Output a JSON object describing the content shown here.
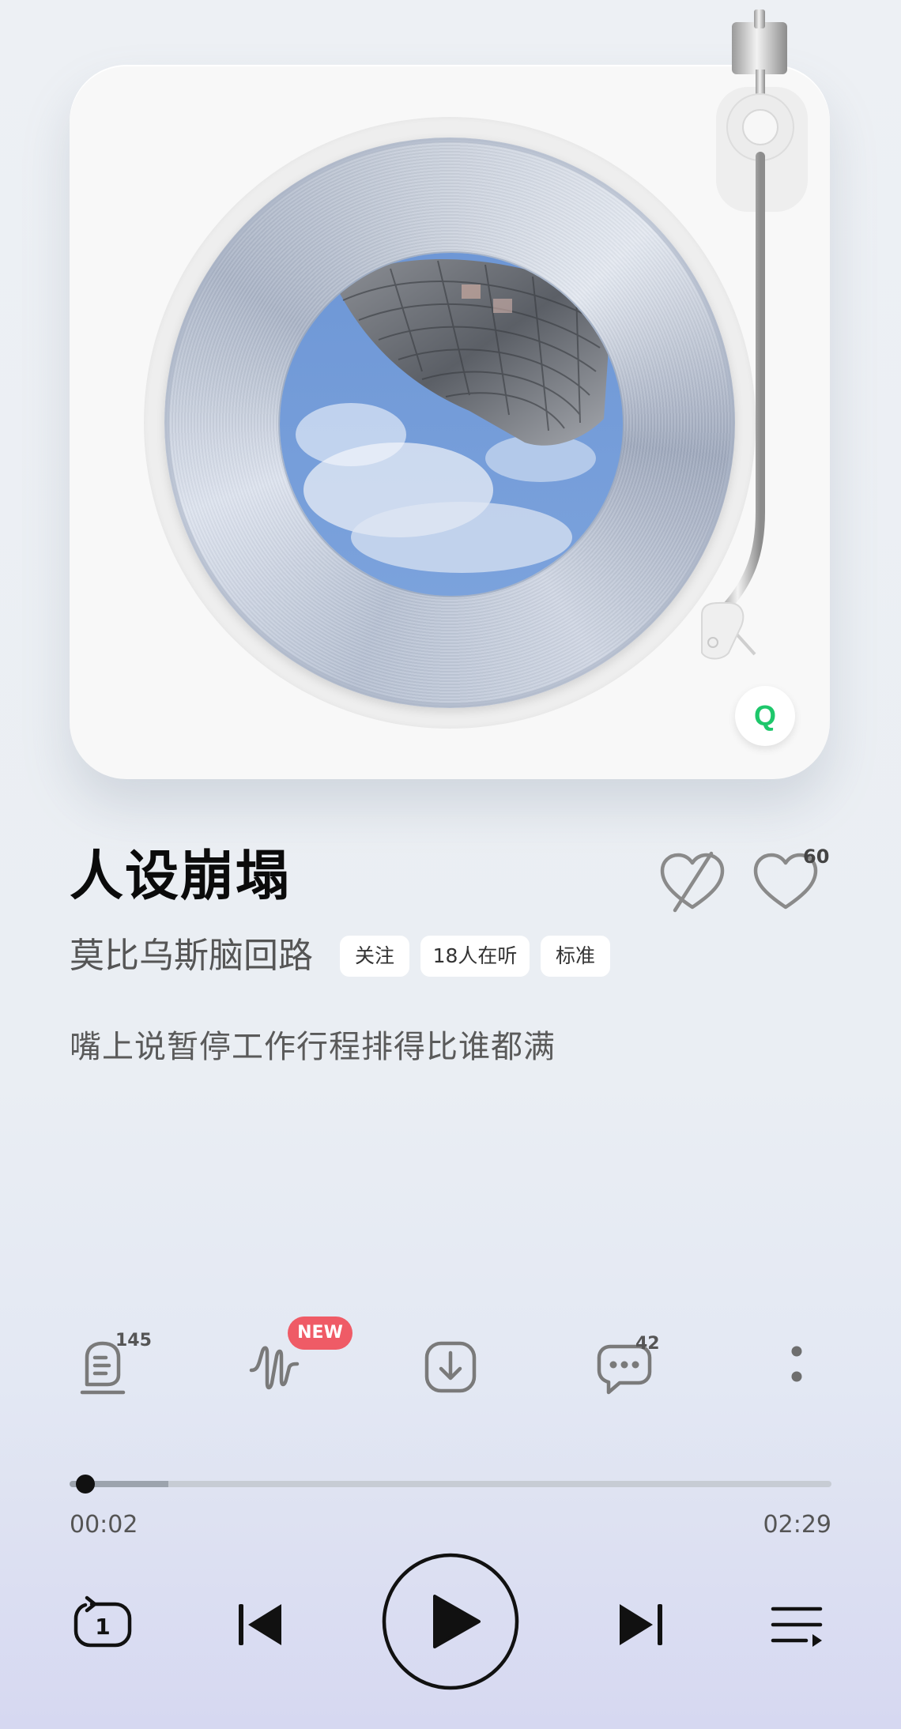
{
  "player": {
    "song_title": "人设崩塌",
    "artist": "莫比乌斯脑回路",
    "follow_label": "关注",
    "listeners_label": "18人在听",
    "quality_label": "标准",
    "lyric_line": "嘴上说暂停工作行程排得比谁都满",
    "like_count": "60",
    "logo_letter": "Q"
  },
  "actions": {
    "lyrics_count": "145",
    "new_badge": "NEW",
    "comments_count": "42"
  },
  "progress": {
    "current_time": "00:02",
    "total_time": "02:29",
    "buffered_fraction": 0.13,
    "played_fraction": 0.013
  },
  "controls": {
    "repeat_label": "1"
  },
  "colors": {
    "accent_green": "#1ec76b",
    "new_badge_red": "#ef5b66"
  }
}
